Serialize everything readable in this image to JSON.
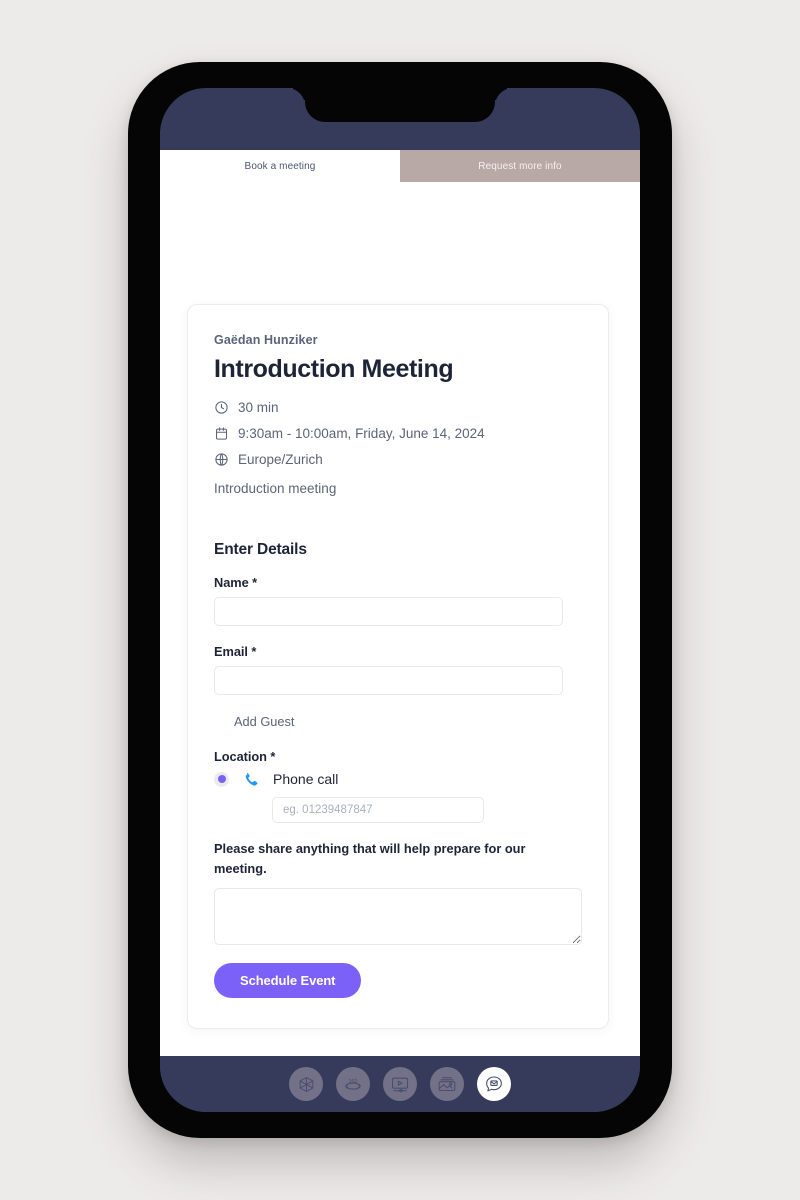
{
  "theme": {
    "page_background": "#edebea",
    "phone_bezel": "#050506",
    "screen_chrome": "#363b5c",
    "accent_purple": "#7b61f8",
    "tab_inactive_background": "#b8a8a6",
    "text_dark": "#1e2437",
    "text_muted": "#5b6478",
    "input_border": "#e6e8ec"
  },
  "tabs": [
    {
      "label": "Book a meeting",
      "active": true
    },
    {
      "label": "Request more info",
      "active": false
    }
  ],
  "card": {
    "host_name": "Gaëdan Hunziker",
    "event_title": "Introduction Meeting",
    "meta": [
      {
        "icon": "clock-icon",
        "text": "30 min"
      },
      {
        "icon": "calendar-icon",
        "text": "9:30am - 10:00am, Friday, June 14, 2024"
      },
      {
        "icon": "globe-icon",
        "text": "Europe/Zurich"
      }
    ],
    "description": "Introduction meeting"
  },
  "form": {
    "heading": "Enter Details",
    "name": {
      "label": "Name *",
      "value": "",
      "placeholder": ""
    },
    "email": {
      "label": "Email *",
      "value": "",
      "placeholder": ""
    },
    "add_guest_label": "Add Guest",
    "location": {
      "label": "Location *",
      "option_label": "Phone call",
      "option_icon": "phone-icon",
      "option_selected": true,
      "phone_input": {
        "value": "",
        "placeholder": "eg. 01239487847"
      }
    },
    "notes": {
      "label": "Please share anything that will help prepare for our meeting.",
      "value": "",
      "placeholder": ""
    },
    "submit_label": "Schedule Event"
  },
  "dock": {
    "items": [
      {
        "icon": "cube-3d-icon",
        "active": false
      },
      {
        "icon": "rotate-360-icon",
        "active": false
      },
      {
        "icon": "video-player-icon",
        "active": false
      },
      {
        "icon": "image-gallery-icon",
        "active": false
      },
      {
        "icon": "chat-message-icon",
        "active": true
      }
    ]
  }
}
